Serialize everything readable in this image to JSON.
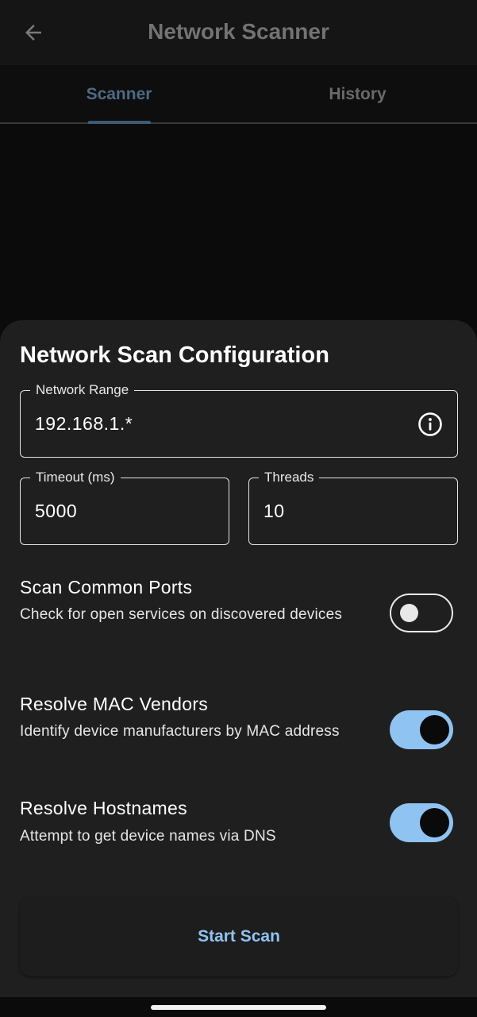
{
  "appbar": {
    "title": "Network Scanner",
    "back_icon": "arrow-left-icon"
  },
  "tabs": [
    {
      "label": "Scanner",
      "selected": true
    },
    {
      "label": "History",
      "selected": false
    }
  ],
  "sheet": {
    "title": "Network Scan Configuration",
    "fields": {
      "network_range": {
        "label": "Network Range",
        "value": "192.168.1.*",
        "icon": "info-icon"
      },
      "timeout": {
        "label": "Timeout (ms)",
        "value": "5000"
      },
      "threads": {
        "label": "Threads",
        "value": "10"
      }
    },
    "settings": [
      {
        "title": "Scan Common Ports",
        "description": "Check for open services on discovered devices",
        "enabled": false
      },
      {
        "title": "Resolve MAC Vendors",
        "description": "Identify device manufacturers by MAC address",
        "enabled": true
      },
      {
        "title": "Resolve Hostnames",
        "description": "Attempt to get device names via DNS",
        "enabled": true
      }
    ],
    "start_button": {
      "label": "Start Scan"
    }
  },
  "colors": {
    "accent": "#8fc3f2",
    "sheet_background": "#1f1f1f",
    "page_background": "#0b0b0b"
  }
}
